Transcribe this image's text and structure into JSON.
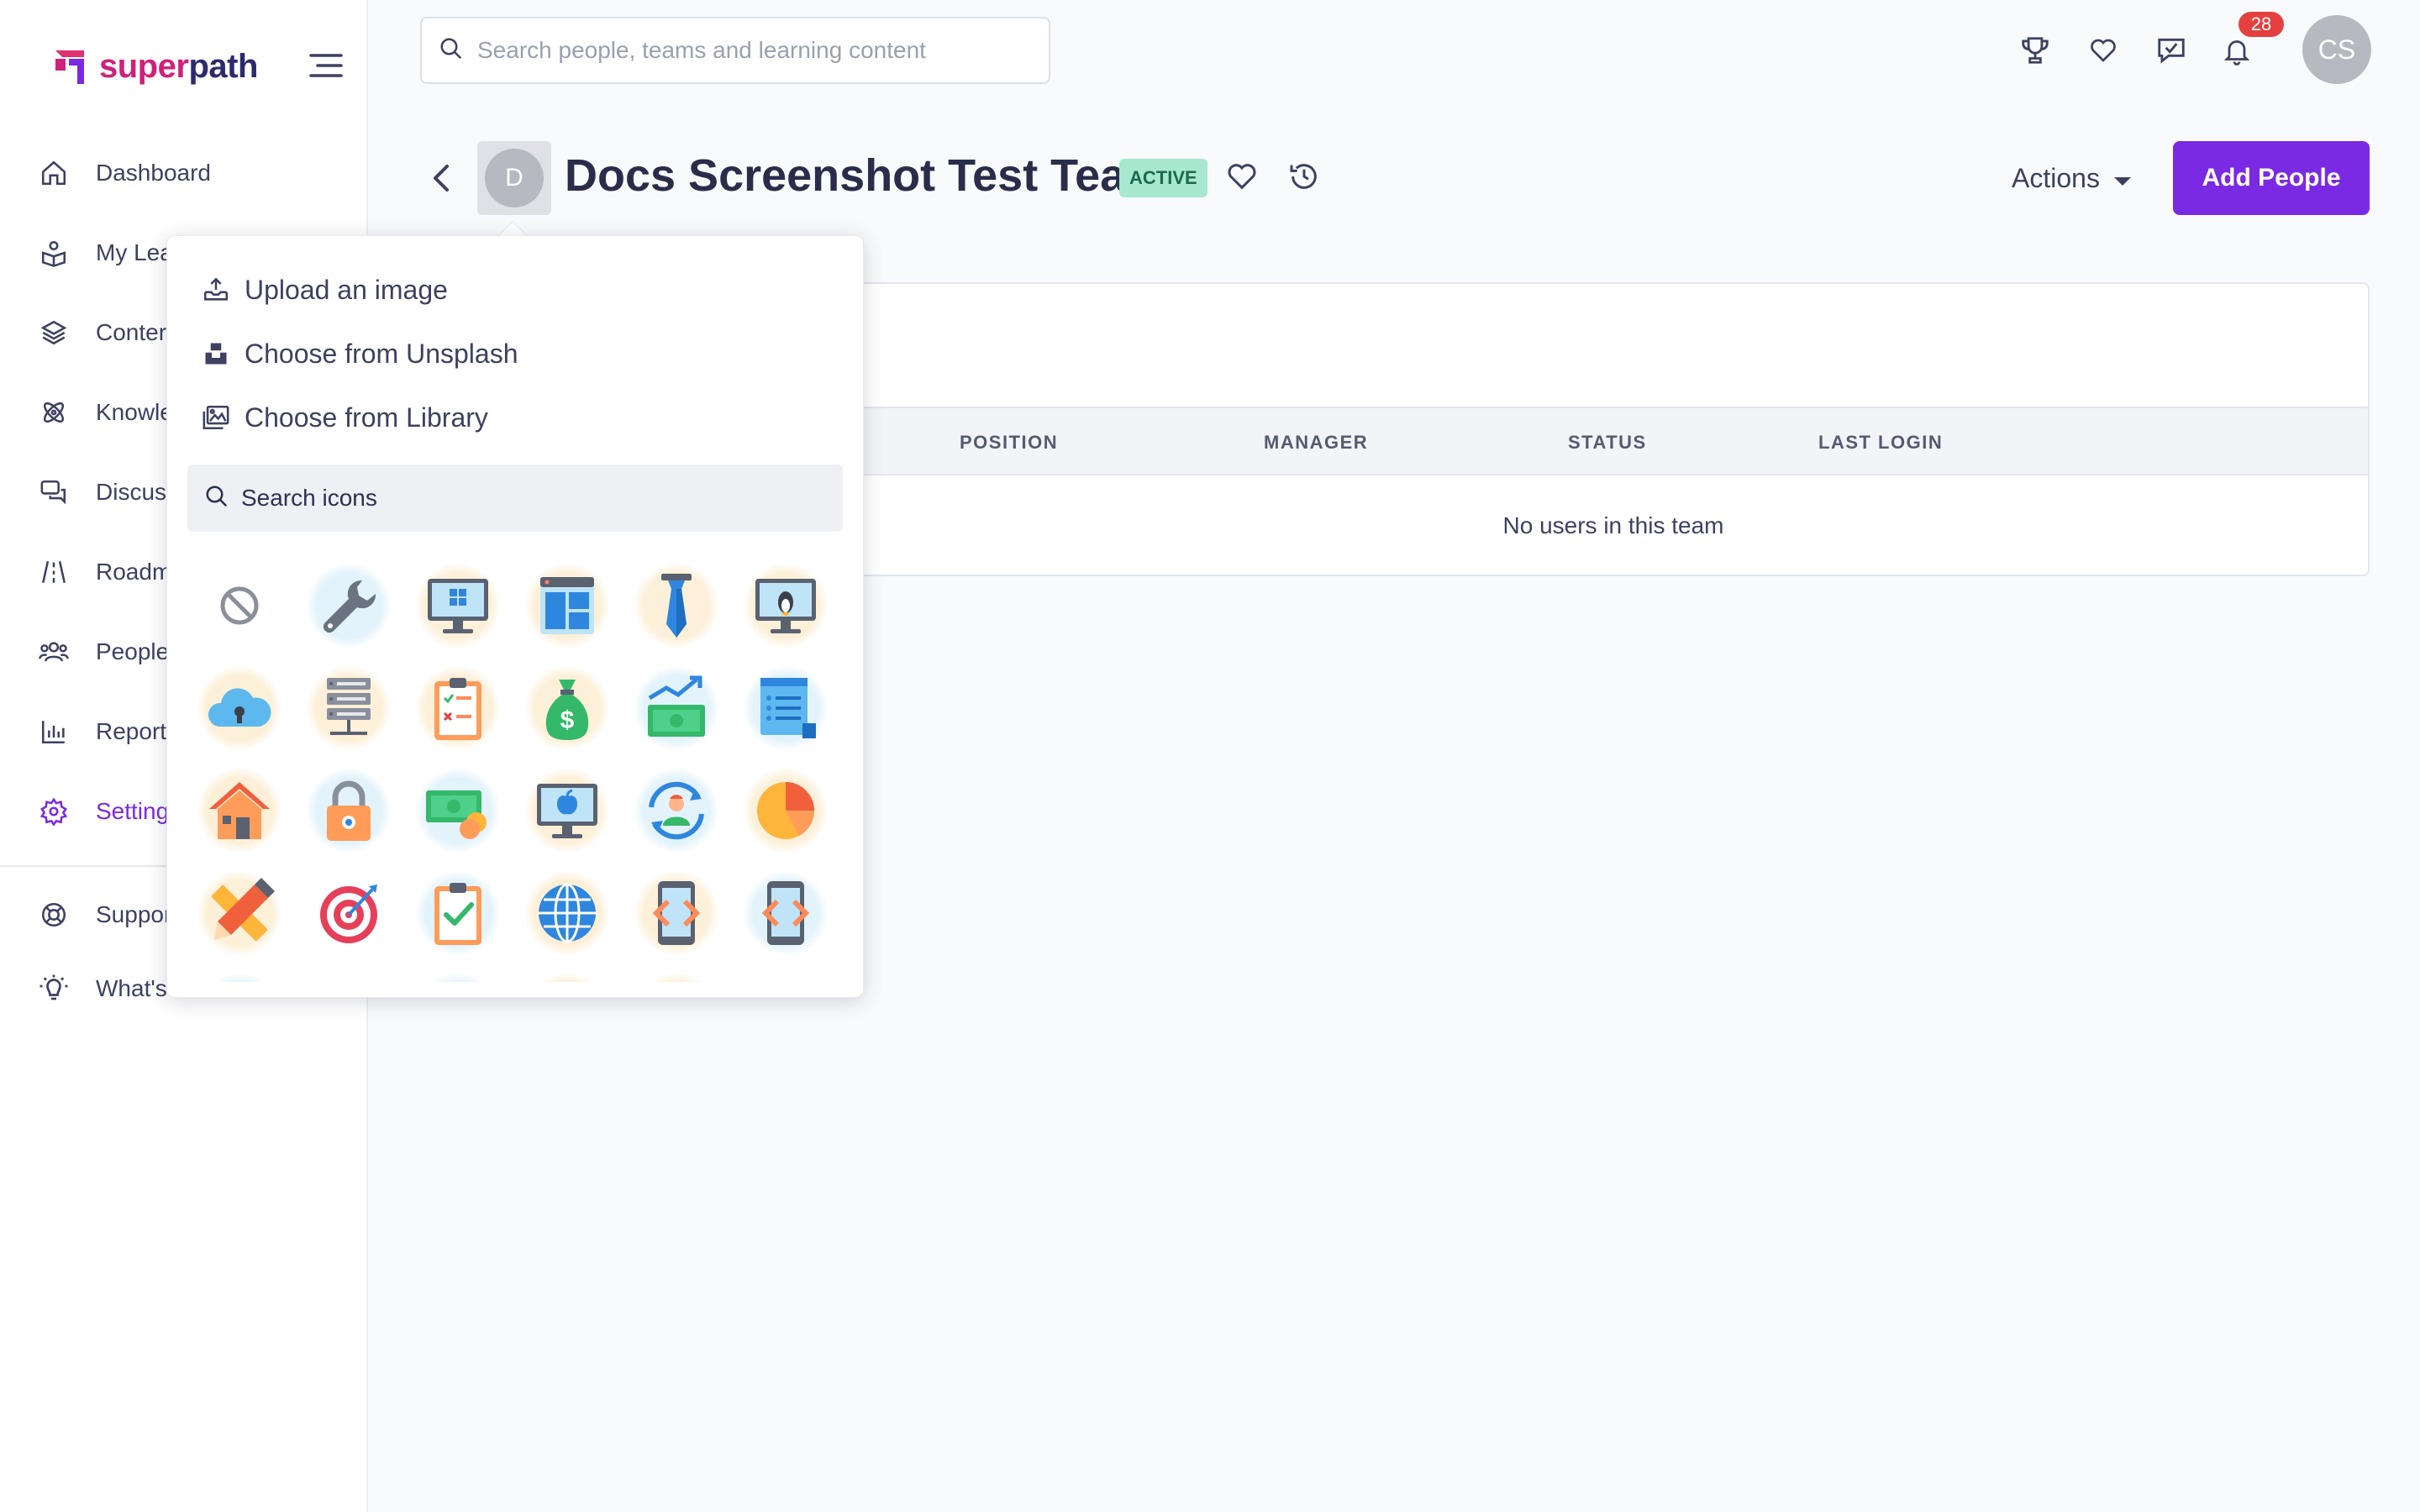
{
  "app": {
    "logo": {
      "part1": "super",
      "part2": "path"
    },
    "brand_colors": {
      "accent": "#7a2ae2",
      "logo_pink": "#d1207a",
      "logo_navy": "#2d2a6e",
      "badge_red": "#e63f3f",
      "active_green": "#a8e8d0"
    }
  },
  "sidebar": {
    "items": [
      {
        "label": "Dashboard",
        "icon": "home-icon"
      },
      {
        "label": "My Lea",
        "icon": "book-reader-icon"
      },
      {
        "label": "Conter",
        "icon": "layers-icon"
      },
      {
        "label": "Knowle",
        "icon": "atom-icon"
      },
      {
        "label": "Discuss",
        "icon": "chat-icon"
      },
      {
        "label": "Roadm",
        "icon": "road-icon"
      },
      {
        "label": "People",
        "icon": "users-icon"
      },
      {
        "label": "Report",
        "icon": "bar-chart-icon"
      },
      {
        "label": "Setting",
        "icon": "gear-icon",
        "active": true
      },
      {
        "label": "Suppor",
        "icon": "lifebuoy-icon"
      },
      {
        "label": "What's",
        "icon": "lightbulb-icon"
      }
    ]
  },
  "topbar": {
    "search_placeholder": "Search people, teams and learning content",
    "notification_count": "28",
    "user_initials": "CS"
  },
  "page": {
    "team_initial": "D",
    "title": "Docs Screenshot Test Team",
    "status": "ACTIVE",
    "actions_label": "Actions",
    "add_people_label": "Add People"
  },
  "table": {
    "columns": [
      "POSITION",
      "MANAGER",
      "STATUS",
      "LAST LOGIN"
    ],
    "empty_message": "No users in this team"
  },
  "image_picker": {
    "options": [
      "Upload an image",
      "Choose from Unsplash",
      "Choose from Library"
    ],
    "search_placeholder": "Search icons",
    "icons": [
      "none-icon",
      "wrench-icon",
      "windows-monitor-icon",
      "web-layout-icon",
      "necktie-icon",
      "linux-monitor-icon",
      "cloud-lock-icon",
      "server-rack-icon",
      "clipboard-checklist-icon",
      "money-bag-icon",
      "cash-growth-icon",
      "document-list-icon",
      "house-icon",
      "padlock-icon",
      "cash-coins-icon",
      "apple-monitor-icon",
      "user-sync-icon",
      "pie-chart-icon",
      "pencil-ruler-icon",
      "target-icon",
      "clipboard-check-icon",
      "globe-icon",
      "mobile-code-icon",
      "mobile-code-alt-icon"
    ]
  }
}
